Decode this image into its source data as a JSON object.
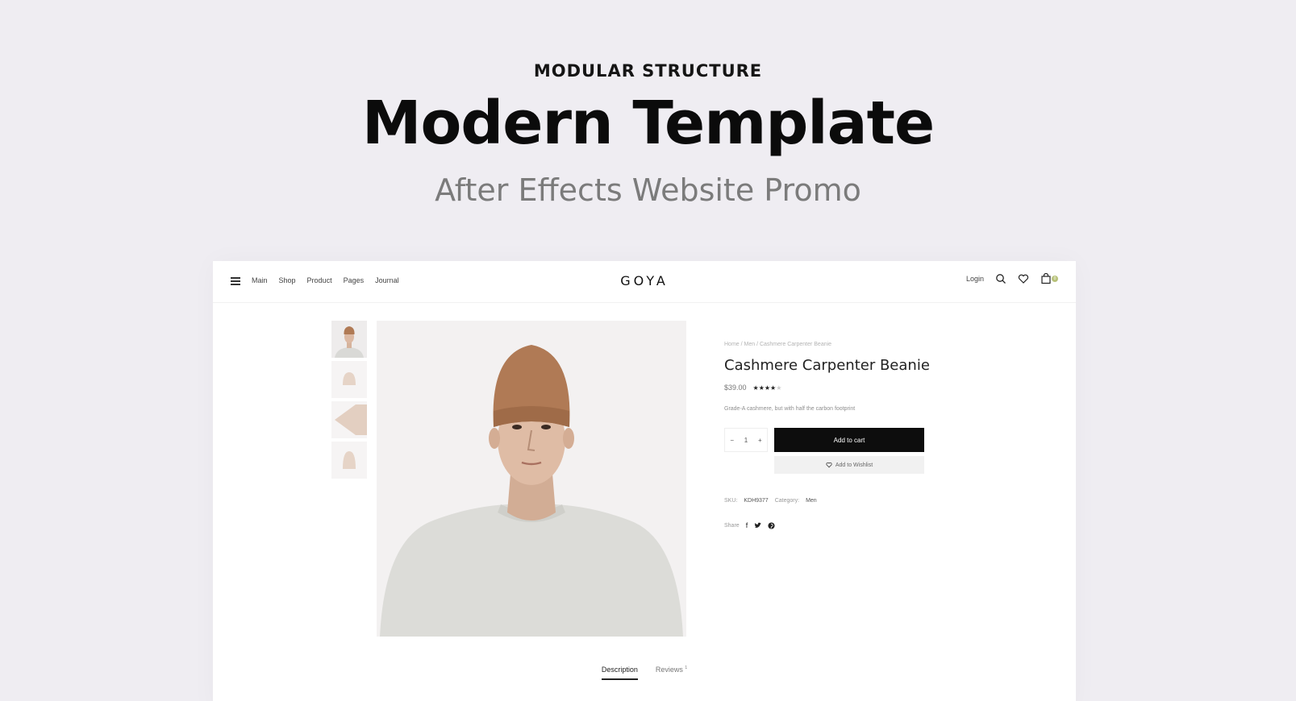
{
  "hero": {
    "eyebrow": "MODULAR STRUCTURE",
    "headline": "Modern Template",
    "subline": "After Effects Website Promo"
  },
  "nav": {
    "menu_icon": "hamburger-icon",
    "links": [
      "Main",
      "Shop",
      "Product",
      "Pages",
      "Journal"
    ],
    "logo": "GOYA",
    "login": "Login",
    "icons": [
      "search-icon",
      "heart-icon",
      "cart-icon"
    ],
    "cart_count": "0"
  },
  "product": {
    "breadcrumb": "Home  /  Men  /  Cashmere Carpenter Beanie",
    "title": "Cashmere Carpenter Beanie",
    "price": "$39.00",
    "rating": 4,
    "rating_max": 5,
    "description": "Grade-A cashmere, but with half the carbon footprint",
    "quantity": "1",
    "qty_minus": "−",
    "qty_plus": "+",
    "add_to_cart": "Add to cart",
    "add_to_wishlist": "Add to Wishlist",
    "sku_label": "SKU:",
    "sku_value": "KDH9377",
    "category_label": "Category:",
    "category_value": "Men",
    "share_label": "Share",
    "share_icons": [
      "facebook-icon",
      "twitter-icon",
      "pinterest-icon"
    ]
  },
  "tabs": {
    "description": "Description",
    "reviews": "Reviews",
    "reviews_count": "1"
  },
  "colors": {
    "background": "#efedf2",
    "accent": "#0d0d0d",
    "beanie": "#b07a55",
    "sweater": "#dcdcd8"
  }
}
